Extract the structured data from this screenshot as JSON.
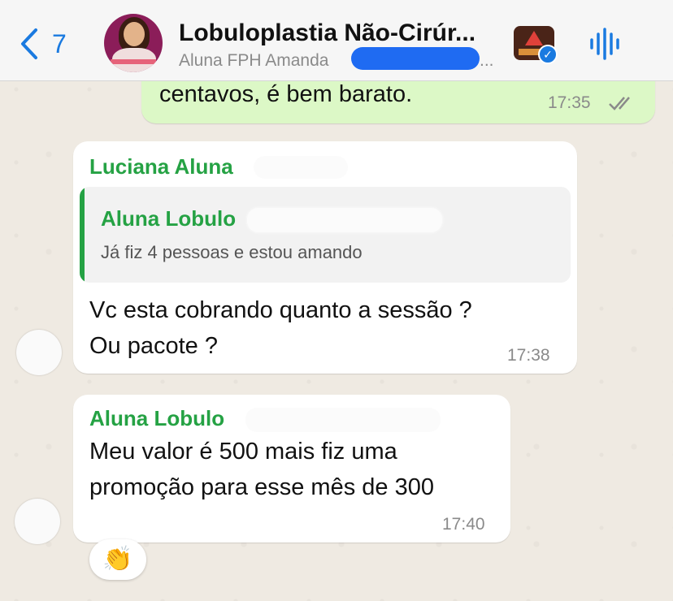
{
  "header": {
    "back_count": "7",
    "title": "Lobuloplastia Não-Cirúr...",
    "subtitle": "Aluna FPH Amanda",
    "subtitle_ellipsis": "..."
  },
  "messages": [
    {
      "direction": "outgoing",
      "text": "centavos, é bem barato.",
      "time": "17:35",
      "status": "read-check-icon"
    },
    {
      "direction": "incoming",
      "sender": "Luciana Aluna",
      "quote": {
        "sender": "Aluna Lobulo",
        "text": "Já fiz 4 pessoas e estou amando"
      },
      "text_line1": "Vc esta cobrando quanto a sessão ?",
      "text_line2": "Ou pacote ?",
      "time": "17:38"
    },
    {
      "direction": "incoming",
      "sender": "Aluna Lobulo",
      "text_line1": "Meu valor é 500 mais fiz uma",
      "text_line2": "promoção para esse mês de 300",
      "time": "17:40",
      "reaction": "👏"
    }
  ],
  "colors": {
    "accent": "#1a7ae0",
    "sender_green": "#25a244",
    "outgoing_bubble": "#dcf8c6",
    "incoming_bubble": "#ffffff"
  }
}
